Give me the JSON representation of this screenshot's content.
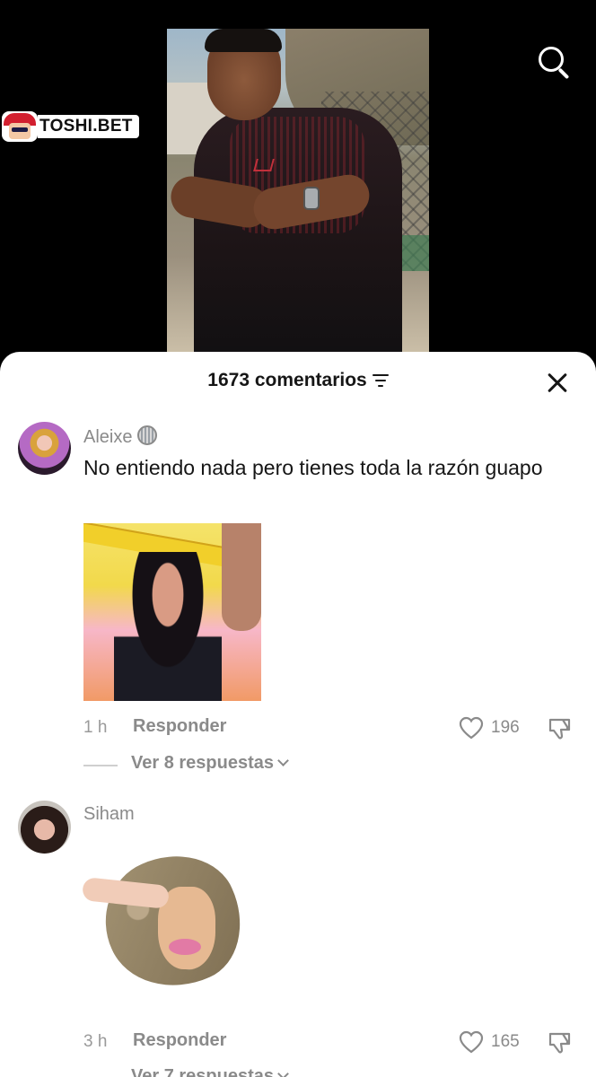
{
  "overlay": {
    "brand": "TOSHI.BET",
    "search_icon": "search-icon"
  },
  "comments_sheet": {
    "title": "1673 comentarios",
    "filter_icon": "sort-filter-icon",
    "close_icon": "close-icon"
  },
  "comments": [
    {
      "username": "Aleixe",
      "badge_icon": "disco-ball-emoji",
      "text": "No entiendo nada pero tienes toda la razón guapo",
      "attachment": "gif-image",
      "time": "1 h",
      "reply_label": "Responder",
      "likes": "196",
      "replies_label": "Ver 8 respuestas"
    },
    {
      "username": "Siham",
      "attachment": "sticker-image",
      "time": "3 h",
      "reply_label": "Responder",
      "likes": "165",
      "replies_label": "Ver 7 respuestas"
    }
  ],
  "colors": {
    "sheet_bg": "#ffffff",
    "video_bg": "#000000",
    "text_primary": "#161616",
    "text_secondary": "#8a8a8a"
  }
}
